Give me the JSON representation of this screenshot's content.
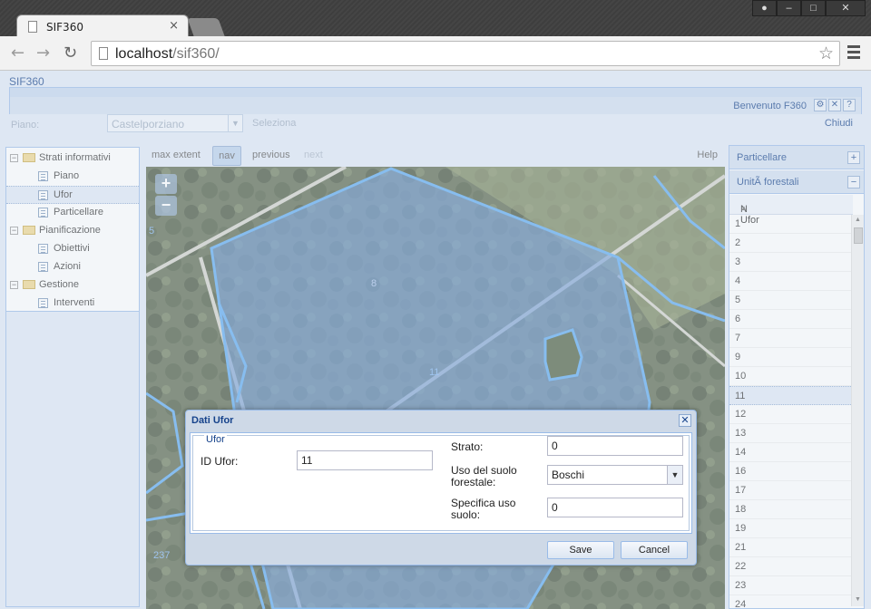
{
  "browser": {
    "tab_title": "SIF360",
    "url_host": "localhost",
    "url_path": "/sif360/"
  },
  "app": {
    "title": "SIF360",
    "welcome": "Benvenuto F360",
    "piano_label": "Piano:",
    "piano_value": "Castelporziano",
    "seleziona": "Seleziona",
    "chiudi": "Chiudi"
  },
  "tree": [
    {
      "label": "Strati informativi",
      "type": "folder",
      "level": 0
    },
    {
      "label": "Piano",
      "type": "leaf",
      "level": 1
    },
    {
      "label": "Ufor",
      "type": "leaf",
      "level": 1,
      "selected": true
    },
    {
      "label": "Particellare",
      "type": "leaf",
      "level": 1
    },
    {
      "label": "Pianificazione",
      "type": "folder",
      "level": 0
    },
    {
      "label": "Obiettivi",
      "type": "leaf",
      "level": 1
    },
    {
      "label": "Azioni",
      "type": "leaf",
      "level": 1
    },
    {
      "label": "Gestione",
      "type": "folder",
      "level": 0
    },
    {
      "label": "Interventi",
      "type": "leaf",
      "level": 1
    }
  ],
  "map_toolbar": {
    "max_extent": "max extent",
    "nav": "nav",
    "previous": "previous",
    "next": "next",
    "help": "Help"
  },
  "map": {
    "labels": [
      "8",
      "11",
      "5",
      "237"
    ]
  },
  "east": {
    "particellare": "Particellare",
    "unita": "UnitÃ  forestali",
    "col_header": "N Ufor",
    "rows": [
      "1",
      "2",
      "3",
      "4",
      "5",
      "6",
      "7",
      "9",
      "10",
      "11",
      "12",
      "13",
      "14",
      "16",
      "17",
      "18",
      "19",
      "21",
      "22",
      "23",
      "24"
    ],
    "selected_row": "11"
  },
  "dialog": {
    "title": "Dati Ufor",
    "legend": "Ufor",
    "id_label": "ID Ufor:",
    "id_value": "11",
    "strato_label": "Strato:",
    "strato_value": "0",
    "uso_label_1": "Uso del suolo",
    "uso_label_2": "forestale:",
    "uso_value": "Boschi",
    "spec_label_1": "Specifica uso",
    "spec_label_2": "suolo:",
    "spec_value": "0",
    "save": "Save",
    "cancel": "Cancel"
  },
  "colors": {
    "polygon_fill": "#5b8fd6",
    "polygon_stroke": "#5aa8f0",
    "panel_bg": "#dfe8f6",
    "header_text": "#15428b"
  }
}
